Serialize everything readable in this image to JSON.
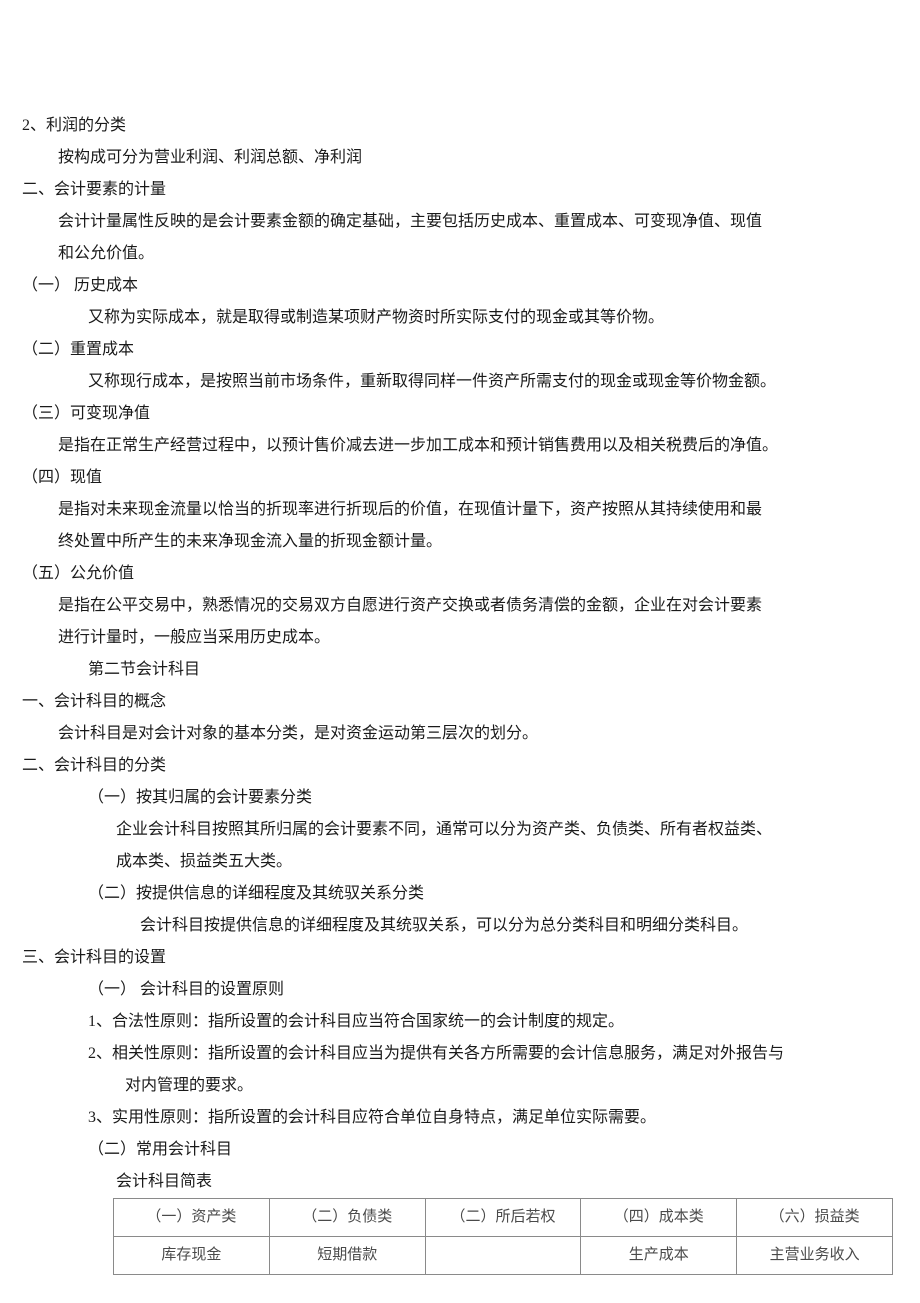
{
  "lines": {
    "l01": "2、利润的分类",
    "l02": "按构成可分为营业利润、利润总额、净利润",
    "l03": "二、会计要素的计量",
    "l04": "会计计量属性反映的是会计要素金额的确定基础，主要包括历史成本、重置成本、可变现净值、现值",
    "l05": "和公允价值。",
    "l06": "（一）  历史成本",
    "l07": "又称为实际成本，就是取得或制造某项财产物资时所实际支付的现金或其等价物。",
    "l08": "（二）重置成本",
    "l09": "又称现行成本，是按照当前市场条件，重新取得同样一件资产所需支付的现金或现金等价物金额。",
    "l10": "（三）可变现净值",
    "l11": "是指在正常生产经营过程中，以预计售价减去进一步加工成本和预计销售费用以及相关税费后的净值。",
    "l12": "（四）现值",
    "l13": "是指对未来现金流量以恰当的折现率进行折现后的价值，在现值计量下，资产按照从其持续使用和最",
    "l14": "终处置中所产生的未来净现金流入量的折现金额计量。",
    "l15": "（五）公允价值",
    "l16": "是指在公平交易中，熟悉情况的交易双方自愿进行资产交换或者债务清偿的金额，企业在对会计要素",
    "l17": "进行计量时，一般应当采用历史成本。",
    "l18": "第二节会计科目",
    "l19": "一、会计科目的概念",
    "l20": "会计科目是对会计对象的基本分类，是对资金运动第三层次的划分。",
    "l21": "二、会计科目的分类",
    "l22": "（一）按其归属的会计要素分类",
    "l23": "企业会计科目按照其所归属的会计要素不同，通常可以分为资产类、负债类、所有者权益类、",
    "l24": "成本类、损益类五大类。",
    "l25": "（二）按提供信息的详细程度及其统驭关系分类",
    "l26": "会计科目按提供信息的详细程度及其统驭关系，可以分为总分类科目和明细分类科目。",
    "l27": "三、会计科目的设置",
    "l28": "（一）  会计科目的设置原则",
    "l29": "1、合法性原则：指所设置的会计科目应当符合国家统一的会计制度的规定。",
    "l30": "2、相关性原则：指所设置的会计科目应当为提供有关各方所需要的会计信息服务，满足对外报告与",
    "l31": "对内管理的要求。",
    "l32": "3、实用性原则：指所设置的会计科目应符合单位自身特点，满足单位实际需要。",
    "l33": "（二）常用会计科目",
    "l34": "会计科目简表"
  },
  "table": {
    "header": [
      "（一）资产类",
      "（二）负债类",
      "（二）所后若权",
      "（四）成本类",
      "（六）损益类"
    ],
    "row1": [
      "库存现金",
      "短期借款",
      "",
      "生产成本",
      "主营业务收入"
    ]
  }
}
